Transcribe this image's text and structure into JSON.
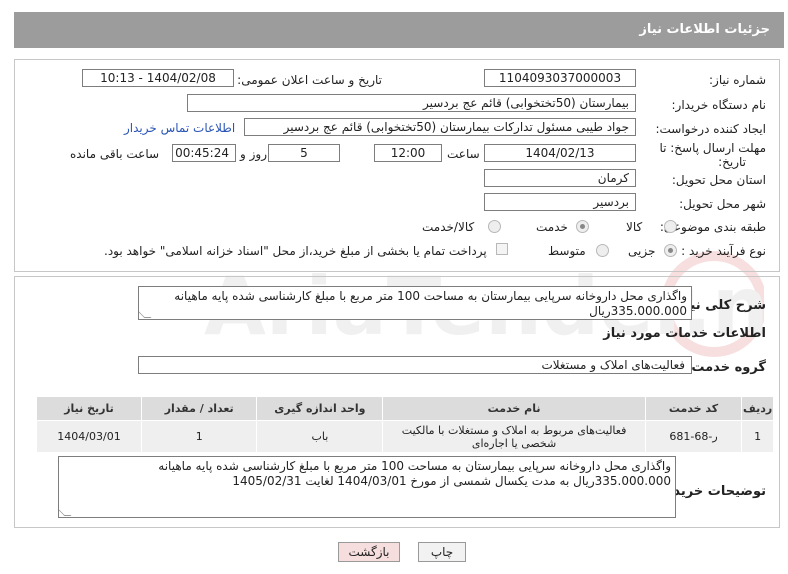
{
  "header": {
    "title": "جزئیات اطلاعات نیاز"
  },
  "form": {
    "need_number_label": "شماره نیاز:",
    "need_number": "1104093037000003",
    "announce_datetime_label": "تاریخ و ساعت اعلان عمومی:",
    "announce_datetime": "1404/02/08 - 10:13",
    "buyer_org_label": "نام دستگاه خریدار:",
    "buyer_org": "بیمارستان (50تختخوابی) قائم  عج  بردسیر",
    "requester_label": "ایجاد کننده درخواست:",
    "requester": "جواد طیبی مسئول تدارکات بیمارستان (50تختخوابی) قائم  عج  بردسیر",
    "contact_link": "اطلاعات تماس خریدار",
    "deadline_label_1": "مهلت ارسال پاسخ: تا",
    "deadline_label_2": "تاریخ:",
    "deadline_date": "1404/02/13",
    "time_label": "ساعت",
    "deadline_time": "12:00",
    "days_value": "5",
    "days_label": "روز و",
    "remaining_time": "00:45:24",
    "remaining_label": "ساعت باقی مانده",
    "province_label": "استان محل تحویل:",
    "province": "کرمان",
    "city_label": "شهر محل تحویل:",
    "city": "بردسیر",
    "category_label": "طبقه بندی موضوعی:",
    "category_options": [
      "کالا",
      "خدمت",
      "کالا/خدمت"
    ],
    "category_selected": "خدمت",
    "process_label": "نوع فرآیند خرید :",
    "process_options": [
      "جزیی",
      "متوسط"
    ],
    "process_selected": "جزیی",
    "payment_note": "پرداخت تمام یا بخشی از مبلغ خرید،از محل \"اسناد خزانه اسلامی\" خواهد بود."
  },
  "details": {
    "summary_label": "شرح کلی نیاز:",
    "summary_text": "واگذاری محل داروخانه سرپایی بیمارستان به مساحت 100 متر مربع با مبلغ کارشناسی شده پایه ماهیانه 335.000.000ریال",
    "services_title": "اطلاعات خدمات مورد نیاز",
    "service_group_label": "گروه خدمت:",
    "service_group": "فعالیت‌های  املاک و مستغلات",
    "table": {
      "headers": [
        "ردیف",
        "کد خدمت",
        "نام خدمت",
        "واحد اندازه گیری",
        "تعداد / مقدار",
        "تاریخ نیاز"
      ],
      "rows": [
        [
          "1",
          "ر-68-681",
          "فعالیت‌های مربوط به املاک و مستغلات با مالکیت شخصی یا اجاره‌ای",
          "باب",
          "1",
          "1404/03/01"
        ]
      ]
    },
    "buyer_notes_label": "توضیحات خریدار:",
    "buyer_notes": "واگذاری محل داروخانه سرپایی بیمارستان به مساحت 100 متر مربع با مبلغ کارشناسی شده پایه ماهیانه 335.000.000ریال به مدت یکسال شمسی از مورخ 1404/03/01 لغایت 1405/02/31"
  },
  "buttons": {
    "print": "چاپ",
    "back": "بازگشت"
  },
  "watermark": "AriaTender.neT",
  "colors": {
    "header_bg": "#9c9c9c",
    "link": "#2a55b5",
    "back_button_bg": "#f6dede"
  }
}
